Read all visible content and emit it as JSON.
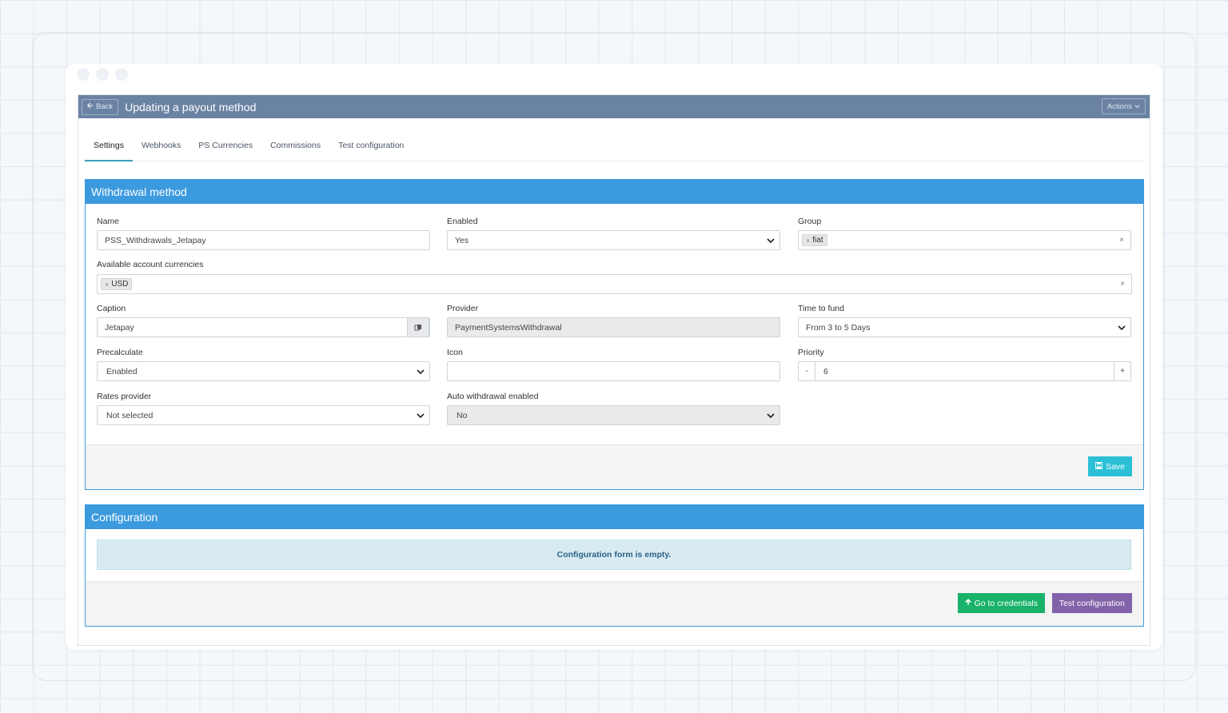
{
  "header": {
    "back_label": "Back",
    "title": "Updating a payout method",
    "actions_label": "Actions"
  },
  "tabs": [
    {
      "label": "Settings",
      "active": true
    },
    {
      "label": "Webhooks",
      "active": false
    },
    {
      "label": "PS Currencies",
      "active": false
    },
    {
      "label": "Commissions",
      "active": false
    },
    {
      "label": "Test configuration",
      "active": false
    }
  ],
  "withdrawal": {
    "title": "Withdrawal method",
    "name": {
      "label": "Name",
      "value": "PSS_Withdrawals_Jetapay"
    },
    "enabled": {
      "label": "Enabled",
      "value": "Yes"
    },
    "group": {
      "label": "Group",
      "tag": "fiat"
    },
    "currencies": {
      "label": "Available account currencies",
      "tag": "USD"
    },
    "caption": {
      "label": "Caption",
      "value": "Jetapay"
    },
    "provider": {
      "label": "Provider",
      "value": "PaymentSystemsWithdrawal"
    },
    "time_to_fund": {
      "label": "Time to fund",
      "value": "From 3 to 5 Days"
    },
    "precalculate": {
      "label": "Precalculate",
      "value": "Enabled"
    },
    "icon": {
      "label": "Icon",
      "value": ""
    },
    "priority": {
      "label": "Priority",
      "value": "6",
      "minus": "-",
      "plus": "+"
    },
    "rates_provider": {
      "label": "Rates provider",
      "value": "Not selected"
    },
    "auto_withdrawal": {
      "label": "Auto withdrawal enabled",
      "value": "No"
    },
    "save_label": "Save"
  },
  "configuration": {
    "title": "Configuration",
    "empty_message": "Configuration form is empty.",
    "credentials_label": "Go to credentials",
    "test_label": "Test configuration"
  },
  "colors": {
    "topbar": "#6b83a3",
    "card_header": "#3c9adf",
    "save": "#2bc0d6",
    "green": "#19b26a",
    "purple": "#8262a8"
  }
}
